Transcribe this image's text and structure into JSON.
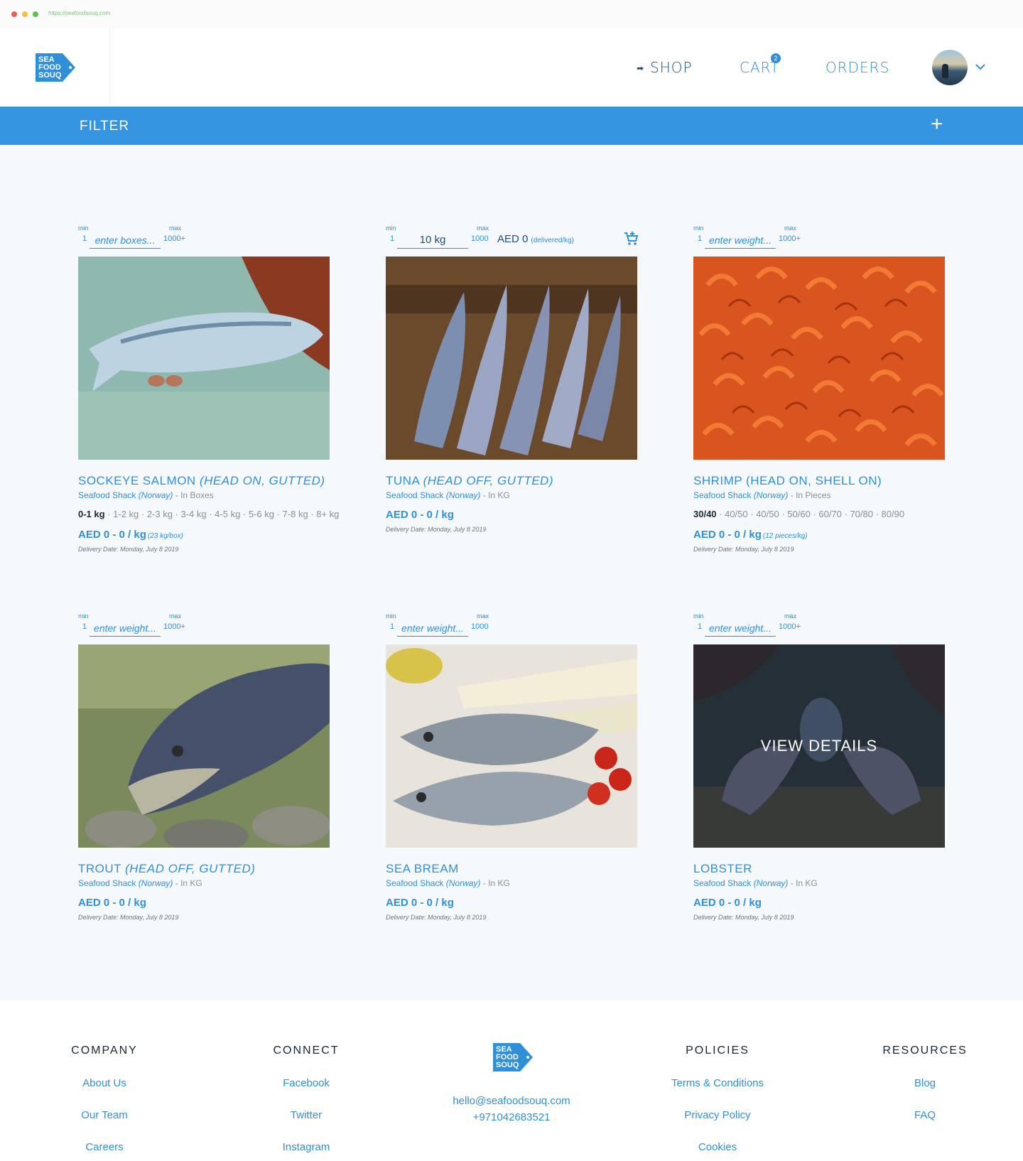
{
  "browser": {
    "url": "https://seafoodsouq.com"
  },
  "brand": {
    "logo_lines": [
      "SEA",
      "FOOD",
      "SOUQ"
    ],
    "color": "#2f8fd8"
  },
  "nav": {
    "shop": "SHOP",
    "cart": "CART",
    "cart_count": "2",
    "orders": "ORDERS"
  },
  "filter": {
    "label": "FILTER",
    "toggle": "+"
  },
  "products": [
    {
      "min_label": "min",
      "min": "1",
      "max_label": "max",
      "max": "1000+",
      "qty_placeholder": "enter boxes...",
      "title": "SOCKEYE SALMON",
      "title_detail": "(HEAD ON, GUTTED)",
      "seller": "Seafood Shack",
      "origin": "(Norway)",
      "unit": " - In Boxes",
      "sizes_selected": "0-1 kg",
      "sizes_rest": " · 1-2 kg · 2-3 kg · 3-4 kg · 4-5 kg · 5-6 kg · 7-8 kg · 8+ kg",
      "price": "AED 0 - 0 / kg",
      "price_note": "(23 kg/box)",
      "delivery": "Delivery Date: Monday, July 8 2019"
    },
    {
      "min_label": "min",
      "min": "1",
      "max_label": "max",
      "max": "1000",
      "qty_value": "10 kg",
      "inline_price": "AED 0",
      "inline_price_note": "(delivered/kg)",
      "title": "TUNA",
      "title_detail": "(HEAD OFF, GUTTED)",
      "seller": "Seafood Shack",
      "origin": "(Norway)",
      "unit": " - In KG",
      "price": "AED 0 - 0 / kg",
      "delivery": "Delivery Date: Monday, July 8 2019"
    },
    {
      "min_label": "min",
      "min": "1",
      "max_label": "max",
      "max": "1000+",
      "qty_placeholder": "enter weight...",
      "title": "SHRIMP (HEAD ON, SHELL ON)",
      "seller": "Seafood Shack",
      "origin": "(Norway)",
      "unit": " - In Pieces",
      "sizes_selected": "30/40",
      "sizes_rest": " · 40/50 · 40/50 · 50/60 · 60/70 · 70/80 · 80/90",
      "price": "AED 0 - 0 / kg",
      "price_note": "(12 pieces/kg)",
      "delivery": "Delivery Date: Monday, July 8 2019"
    },
    {
      "min_label": "min",
      "min": "1",
      "max_label": "max",
      "max": "1000+",
      "qty_placeholder": "enter weight...",
      "title": "TROUT",
      "title_detail": "(HEAD OFF, GUTTED)",
      "seller": "Seafood Shack",
      "origin": "(Norway)",
      "unit": " - In KG",
      "price": "AED 0 - 0 / kg",
      "delivery": "Delivery Date: Monday, July 8 2019"
    },
    {
      "min_label": "min",
      "min": "1",
      "max_label": "max",
      "max": "1000",
      "qty_placeholder": "enter weight...",
      "title": "SEA BREAM",
      "seller": "Seafood Shack",
      "origin": "(Norway)",
      "unit": " - In KG",
      "price": "AED 0 - 0 / kg",
      "delivery": "Delivery Date: Monday, July 8 2019"
    },
    {
      "min_label": "min",
      "min": "1",
      "max_label": "max",
      "max": "1000+",
      "qty_placeholder": "enter weight...",
      "overlay": "VIEW DETAILS",
      "title": "LOBSTER",
      "seller": "Seafood Shack",
      "origin": "(Norway)",
      "unit": " - In KG",
      "price": "AED 0 - 0 / kg",
      "delivery": "Delivery Date: Monday, July 8 2019"
    }
  ],
  "footer": {
    "company": {
      "heading": "COMPANY",
      "links": [
        "About Us",
        "Our Team",
        "Careers"
      ]
    },
    "connect": {
      "heading": "CONNECT",
      "links": [
        "Facebook",
        "Twitter",
        "Instagram"
      ]
    },
    "contact": {
      "email": "hello@seafoodsouq.com",
      "phone": "+971042683521"
    },
    "policies": {
      "heading": "POLICIES",
      "links": [
        "Terms & Conditions",
        "Privacy Policy",
        "Cookies"
      ]
    },
    "resources": {
      "heading": "RESOURCES",
      "links": [
        "Blog",
        "FAQ"
      ]
    }
  }
}
